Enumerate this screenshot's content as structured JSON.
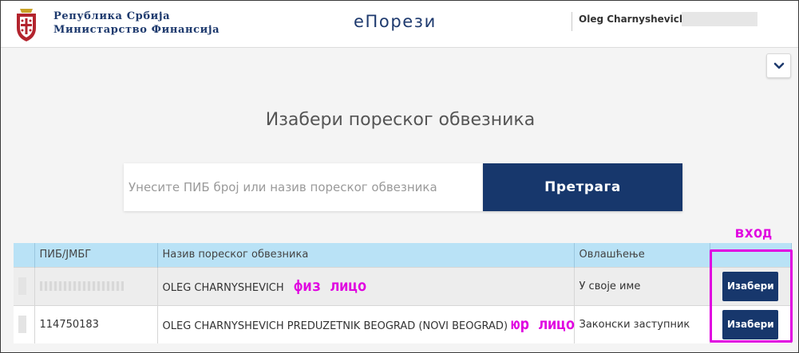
{
  "header": {
    "ministry_line1": "Република Србија",
    "ministry_line2": "Министарство Финансија",
    "logo_text": "еПорези",
    "user_name": "Oleg Charnyshevich,"
  },
  "page": {
    "title": "Изабери пореског обвезника",
    "search_placeholder": "Унесите ПИБ број или назив пореског обвезника",
    "search_button": "Претрага"
  },
  "table": {
    "columns": [
      "",
      "ПИБ/ЈМБГ",
      "Назив пореског обвезника",
      "Овлашћење",
      ""
    ],
    "rows": [
      {
        "pib": "",
        "name": "OLEG CHARNYSHEVICH",
        "authorization": "У своје име",
        "action": "Изабери"
      },
      {
        "pib": "114750183",
        "name": "OLEG CHARNYSHEVICH PREDUZETNIK BEOGRAD (NOVI BEOGRAD)",
        "authorization": "Законски заступник",
        "action": "Изабери"
      }
    ]
  },
  "annotations": {
    "entry": "вход",
    "individual": "физ  лицо",
    "legal": "юр  лицо"
  },
  "colors": {
    "brand": "#17376c",
    "table_header": "#b9e2f6",
    "annotation": "#e000e0"
  },
  "icons": {
    "crest": "serbian-coat-of-arms-icon",
    "collapse": "chevron-down-icon"
  }
}
